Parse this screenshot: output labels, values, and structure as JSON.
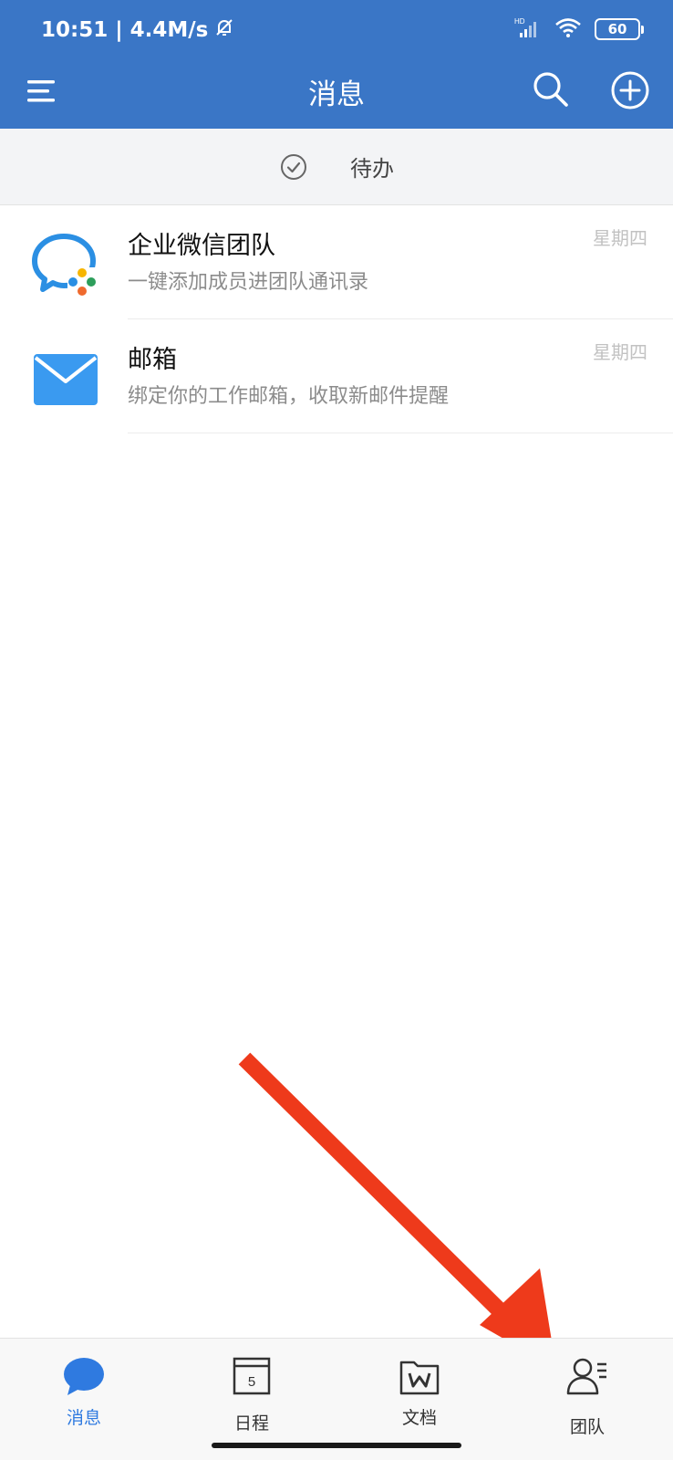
{
  "status_bar": {
    "time": "10:51 | 4.4M/s",
    "battery": "60",
    "network_badge": "HD"
  },
  "header": {
    "title": "消息"
  },
  "todo": {
    "label": "待办"
  },
  "messages": [
    {
      "title": "企业微信团队",
      "subtitle": "一键添加成员进团队通讯录",
      "time": "星期四",
      "icon": "wecom-team-logo-icon"
    },
    {
      "title": "邮箱",
      "subtitle": "绑定你的工作邮箱，收取新邮件提醒",
      "time": "星期四",
      "icon": "mail-envelope-icon"
    }
  ],
  "calendar_day": "5",
  "bottom_nav": [
    {
      "label": "消息",
      "icon": "chat-bubble-icon",
      "active": true
    },
    {
      "label": "日程",
      "icon": "calendar-icon",
      "active": false
    },
    {
      "label": "文档",
      "icon": "document-folder-icon",
      "active": false
    },
    {
      "label": "团队",
      "icon": "contacts-person-icon",
      "active": false
    }
  ],
  "colors": {
    "header_bg": "#3a76c6",
    "active_tab": "#2f7ae0",
    "arrow": "#ee3a1b"
  }
}
